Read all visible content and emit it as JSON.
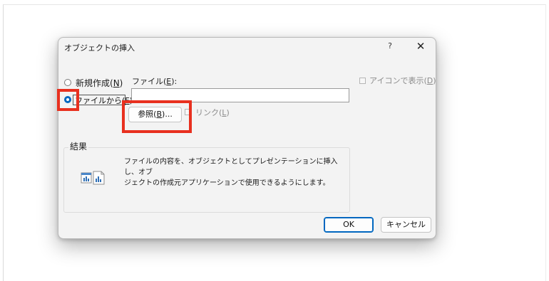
{
  "dialog": {
    "title": "オブジェクトの挿入",
    "help_label": "?",
    "close_label": "✕"
  },
  "options": {
    "new_pre": "新規作成(",
    "new_key": "N",
    "new_post": ")",
    "from_file_pre": "ファイルから(",
    "from_file_key": "F",
    "from_file_post": ")",
    "selected": "from_file"
  },
  "file": {
    "label_pre": "ファイル(",
    "label_key": "E",
    "label_post": "):",
    "value": "",
    "browse_pre": "参照(",
    "browse_key": "B",
    "browse_post": ")...",
    "link_pre": "リンク(",
    "link_key": "L",
    "link_post": ")",
    "link_checked": false
  },
  "display_as_icon": {
    "pre": "アイコンで表示(",
    "key": "D",
    "post": ")",
    "checked": false
  },
  "result": {
    "label": "結果",
    "description_line1": "ファイルの内容を、オブジェクトとしてプレゼンテーションに挿入し、オブ",
    "description_line2": "ジェクトの作成元アプリケーションで使用できるようにします。",
    "icon": "chart-document-icon"
  },
  "buttons": {
    "ok": "OK",
    "cancel": "キャンセル"
  },
  "colors": {
    "highlight": "#e8301f",
    "accent": "#0067c0"
  }
}
